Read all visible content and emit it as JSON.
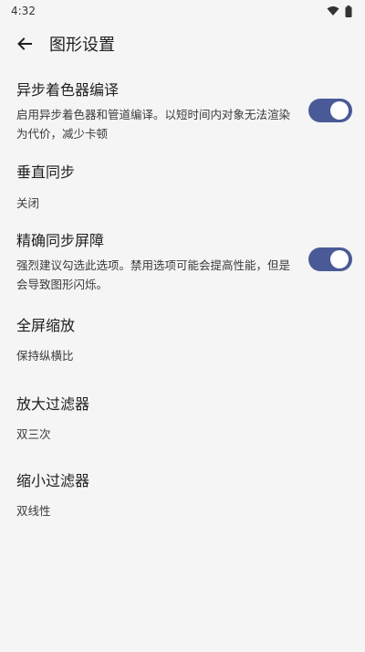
{
  "status_bar": {
    "time": "4:32",
    "icons": [
      "wifi-icon",
      "battery-icon"
    ]
  },
  "app_bar": {
    "title": "图形设置",
    "back_icon": "arrow-left-icon"
  },
  "settings": [
    {
      "title": "异步着色器编译",
      "summary": "启用异步着色器和管道编译。以短时间内对象无法渲染为代价，减少卡顿",
      "switch_on": true
    },
    {
      "title": "垂直同步",
      "summary": "关闭"
    },
    {
      "title": "精确同步屏障",
      "summary": "强烈建议勾选此选项。禁用选项可能会提高性能，但是会导致图形闪烁。",
      "switch_on": true
    },
    {
      "title": "全屏缩放",
      "summary": "保持纵横比"
    },
    {
      "title": "放大过滤器",
      "summary": "双三次"
    },
    {
      "title": "缩小过滤器",
      "summary": "双线性"
    }
  ],
  "colors": {
    "accent": "#4a5a96",
    "background": "#f5f5f6"
  }
}
